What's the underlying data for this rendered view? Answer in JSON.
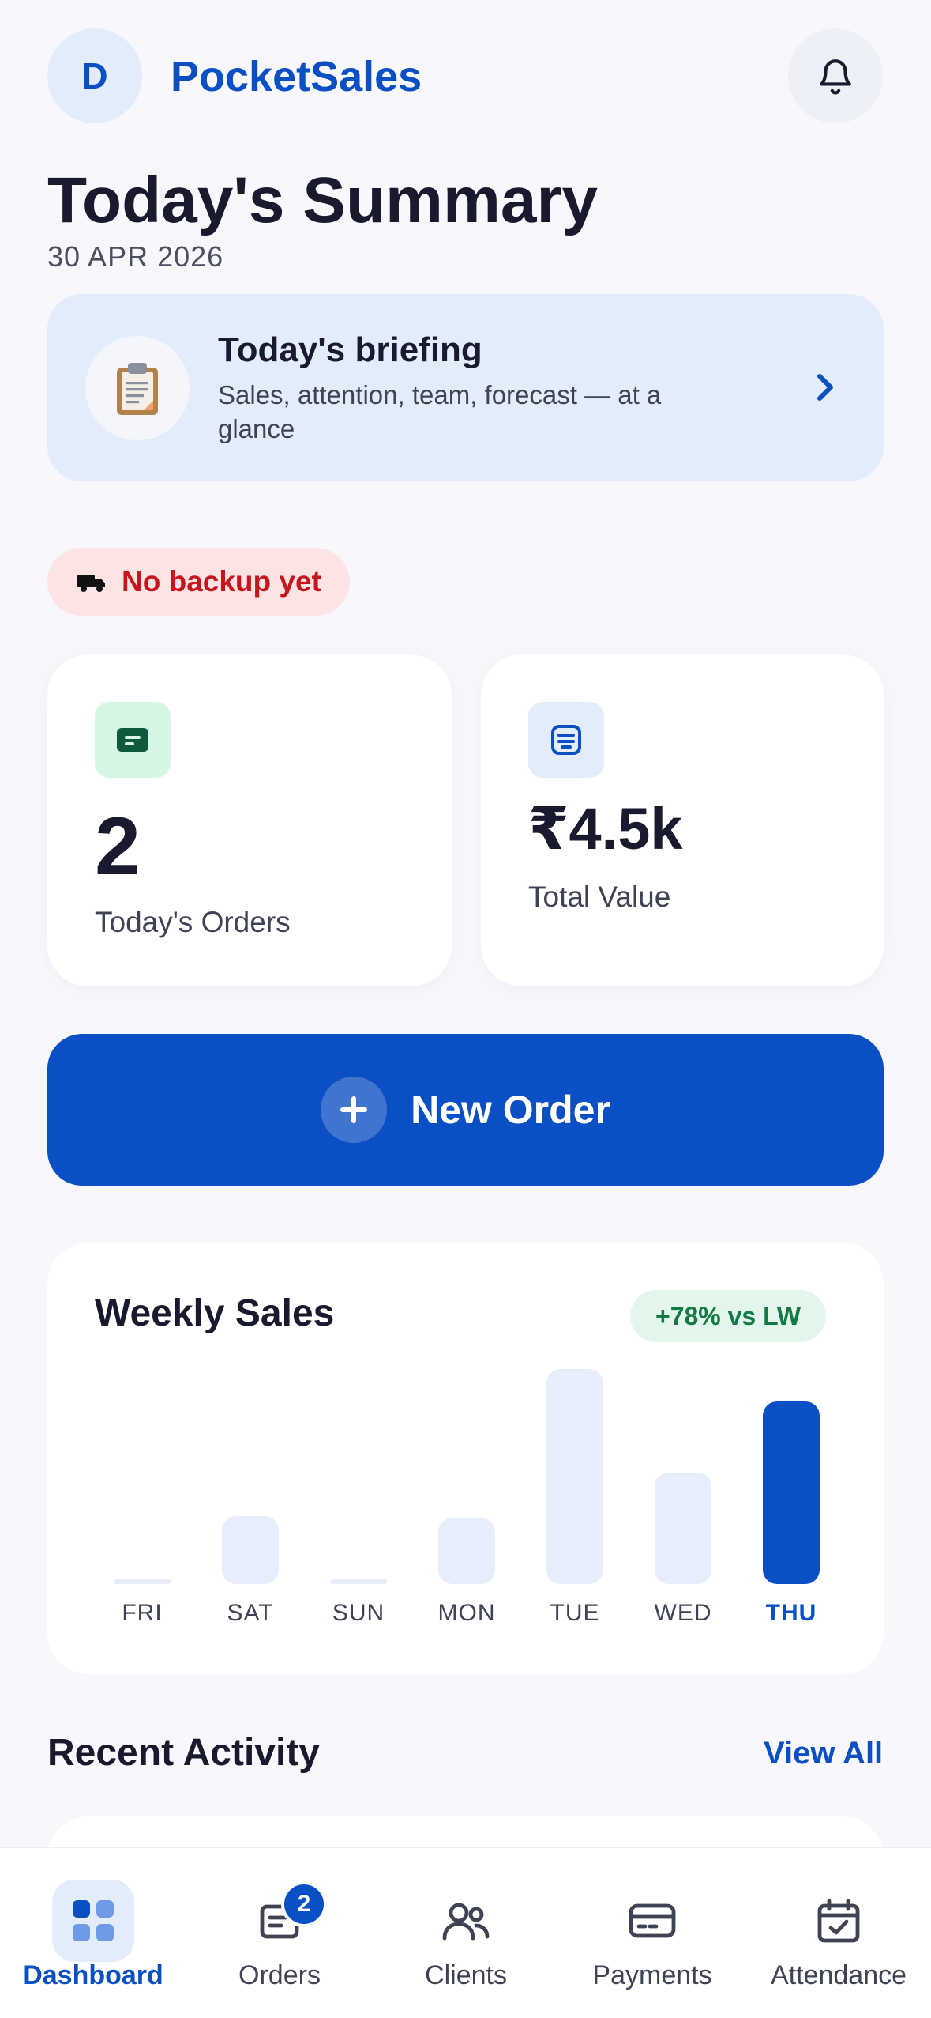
{
  "header": {
    "avatar_initial": "D",
    "app_name": "PocketSales",
    "notification_icon": "bell-icon"
  },
  "summary": {
    "title": "Today's Summary",
    "date": "30 APR 2026"
  },
  "briefing": {
    "icon": "clipboard-icon",
    "title": "Today's briefing",
    "subtitle": "Sales, attention, team, forecast — at a glance"
  },
  "backup": {
    "label": "No backup yet",
    "icon": "truck-icon"
  },
  "stats": {
    "orders": {
      "value": "2",
      "label": "Today's Orders",
      "icon": "order-icon"
    },
    "total": {
      "value": "₹4.5k",
      "label": "Total Value",
      "icon": "receipt-icon"
    }
  },
  "new_order": {
    "label": "New Order",
    "icon": "plus-icon"
  },
  "weekly_sales": {
    "title": "Weekly Sales",
    "badge": "+78% vs LW"
  },
  "chart_data": {
    "type": "bar",
    "categories": [
      "FRI",
      "SAT",
      "SUN",
      "MON",
      "TUE",
      "WED",
      "THU"
    ],
    "values": [
      0.05,
      1.9,
      0.05,
      1.85,
      6.0,
      3.1,
      5.1
    ],
    "active_index": 6,
    "title": "Weekly Sales",
    "xlabel": "",
    "ylabel": "",
    "grid": false,
    "colors": {
      "inactive": "#e6edfb",
      "active": "#0a4fc4"
    }
  },
  "recent": {
    "title": "Recent Activity",
    "view_all": "View All"
  },
  "nav": {
    "items": [
      {
        "label": "Dashboard",
        "icon": "dashboard-icon",
        "active": true
      },
      {
        "label": "Orders",
        "icon": "orders-icon",
        "badge": "2"
      },
      {
        "label": "Clients",
        "icon": "clients-icon"
      },
      {
        "label": "Payments",
        "icon": "payments-icon"
      },
      {
        "label": "Attendance",
        "icon": "attendance-icon"
      }
    ]
  },
  "colors": {
    "brand": "#0a4fc4",
    "background": "#f7f7fc",
    "danger": "#c4161c",
    "success": "#137a45"
  }
}
